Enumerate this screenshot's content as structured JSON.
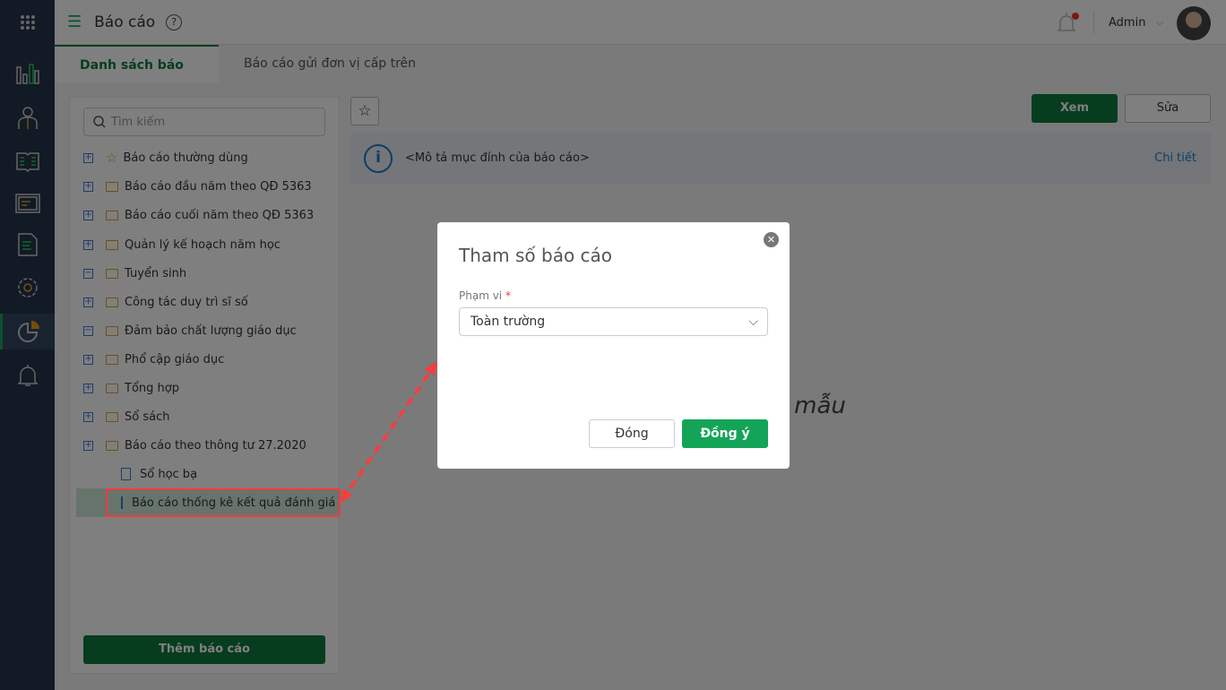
{
  "header": {
    "title": "Báo cáo",
    "help": "?",
    "user": "Admin"
  },
  "tabs": [
    {
      "label": "Danh sách báo cáo"
    },
    {
      "label": "Báo cáo gửi đơn vị cấp trên"
    }
  ],
  "tree": {
    "search_placeholder": "Tìm kiếm",
    "items": [
      {
        "label": "Báo cáo thường dùng",
        "toggle": "+"
      },
      {
        "label": "Báo cáo đầu năm theo QĐ 5363",
        "toggle": "+"
      },
      {
        "label": "Báo cáo cuối năm theo QĐ 5363",
        "toggle": "+"
      },
      {
        "label": "Quản lý kế hoạch năm học",
        "toggle": "+"
      },
      {
        "label": "Tuyển sinh",
        "toggle": "−"
      },
      {
        "label": "Công tác duy trì sĩ số",
        "toggle": "+"
      },
      {
        "label": "Đảm bảo chất lượng giáo dục",
        "toggle": "−"
      },
      {
        "label": "Phổ cập giáo dục",
        "toggle": "+"
      },
      {
        "label": "Tổng hợp",
        "toggle": "+"
      },
      {
        "label": "Sổ sách",
        "toggle": "+"
      },
      {
        "label": "Báo cáo theo thông tư 27.2020",
        "toggle": "+"
      },
      {
        "label": "Sổ học bạ"
      },
      {
        "label": "Báo cáo thống kê kết quả đánh giá xế"
      }
    ],
    "add_button": "Thêm báo cáo"
  },
  "toolbar": {
    "view": "Xem",
    "edit": "Sửa"
  },
  "info": {
    "description": "<Mô tả mục đính của báo cáo>",
    "detail_link": "Chi tiết"
  },
  "empty_text": "o mẫu",
  "modal": {
    "title": "Tham số báo cáo",
    "field_label": "Phạm vi",
    "required": "*",
    "field_value": "Toàn trường",
    "cancel": "Đóng",
    "confirm": "Đồng ý"
  },
  "colors": {
    "primary": "#0f7a3f",
    "confirm": "#14a458",
    "link": "#1e7ac8",
    "annotation": "#ff3b3b"
  }
}
